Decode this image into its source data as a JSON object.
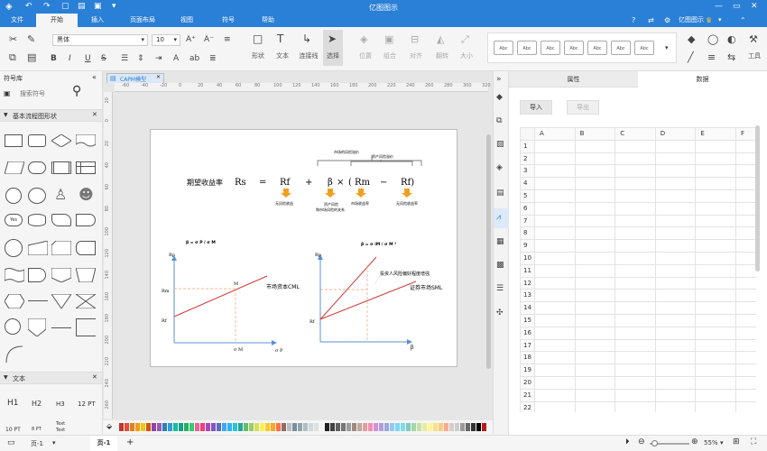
{
  "app": {
    "title": "亿图图示"
  },
  "menu_tabs": [
    "文件",
    "开始",
    "插入",
    "页面布局",
    "视图",
    "符号",
    "帮助"
  ],
  "account": {
    "label": "亿图图示"
  },
  "ribbon": {
    "font_name": "黑体",
    "font_size": "10",
    "tools": {
      "shape": "形状",
      "text": "文本",
      "connector": "连接线",
      "select": "选择",
      "position": "位置",
      "group": "组合",
      "align": "对齐",
      "flip": "翻转",
      "size": "大小",
      "tools": "工具"
    },
    "style_label": "Abc",
    "letter_b": "B",
    "letter_i": "I",
    "letter_u": "U",
    "letter_s": "S"
  },
  "left_panel": {
    "title": "符号库",
    "search_placeholder": "搜索符号",
    "section_shapes": "基本流程图形状",
    "yes_label": "Yes",
    "section_text": "文本",
    "text_samples": [
      "H1",
      "H2",
      "H3",
      "12 PT",
      "10 PT",
      "8 PT",
      "Text",
      "Text"
    ]
  },
  "doc_tab": {
    "label": "CAPM模型"
  },
  "ruler": {
    "top": [
      "-60",
      "-40",
      "-20",
      "0",
      "20",
      "40",
      "60",
      "80",
      "100",
      "120",
      "140",
      "160",
      "180",
      "200",
      "220",
      "240",
      "260",
      "280",
      "300",
      "320"
    ],
    "left": [
      "20",
      "0",
      "20",
      "40",
      "60",
      "80",
      "100",
      "120",
      "140",
      "160",
      "180",
      "200",
      "220",
      "240",
      "260"
    ]
  },
  "diagram": {
    "formula": {
      "label": "期望收益率",
      "rs": "Rs",
      "eq": "=",
      "rf": "Rf",
      "plus": "+",
      "beta": "β",
      "times": "×",
      "lparen": "(",
      "rm": "Rm",
      "minus": "−",
      "rf2": "Rf)"
    },
    "top_notes": {
      "market_risk": "市场的风险溢价",
      "asset_risk": "资产风险溢价"
    },
    "bottom_notes": {
      "riskfree": "无风险收益",
      "asset_beta": "资产风险\n和市场风险的关系",
      "market_return": "市场收益率",
      "riskfree2": "无风险收益率"
    },
    "left_chart": {
      "formula": "β = σ P / σ M",
      "y_axis": "Rp",
      "rm": "Rm",
      "rf": "Rf",
      "m": "M",
      "line": "市场资本CML",
      "x_m": "σ M",
      "x_axis": "σ P"
    },
    "right_chart": {
      "formula": "β = σ iM / σ M  ²",
      "y_axis": "Rp",
      "rf": "Rf",
      "note": "投资人风险偏好程度增强",
      "line": "证券市场SML",
      "x_axis": "β"
    }
  },
  "right_panel": {
    "tab_properties": "属性",
    "tab_data": "数据",
    "import_button": "导入",
    "export_button": "导出",
    "columns": [
      "A",
      "B",
      "C",
      "D",
      "E",
      "F"
    ],
    "rows": [
      "1",
      "2",
      "3",
      "4",
      "5",
      "6",
      "7",
      "8",
      "9",
      "10",
      "11",
      "12",
      "13",
      "14",
      "15",
      "16",
      "17",
      "18",
      "19",
      "20",
      "21",
      "22"
    ]
  },
  "status": {
    "page_label": "页-1",
    "page_tab": "页-1",
    "add": "+",
    "zoom": "55%"
  },
  "colors": {
    "accent": "#2a7fd6",
    "highlight_line": "#d23a3a",
    "dashed": "#f0a070",
    "arrow": "#f0a020",
    "axis": "#5b8fd6"
  }
}
